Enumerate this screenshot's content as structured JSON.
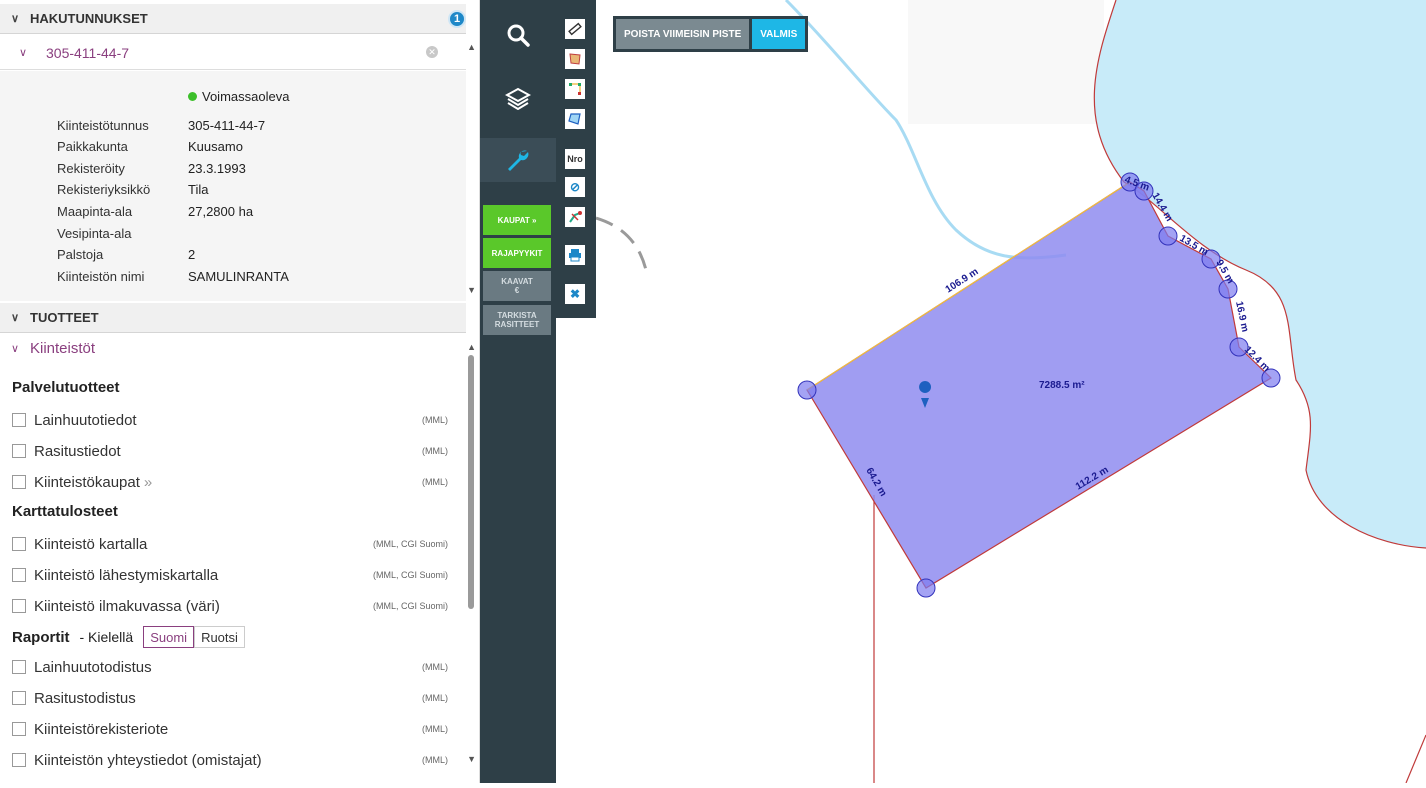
{
  "hits": {
    "title": "HAKUTUNNUKSET",
    "count": "1",
    "parcel_id": "305-411-44-7"
  },
  "details": {
    "status": "Voimassaoleva",
    "rows": [
      {
        "k": "Kiinteistötunnus",
        "v": "305-411-44-7"
      },
      {
        "k": "Paikkakunta",
        "v": "Kuusamo"
      },
      {
        "k": "Rekisteröity",
        "v": "23.3.1993"
      },
      {
        "k": "Rekisteriyksikkö",
        "v": "Tila"
      },
      {
        "k": "Maapinta-ala",
        "v": "27,2800 ha"
      },
      {
        "k": "Vesipinta-ala",
        "v": ""
      },
      {
        "k": "Palstoja",
        "v": "2"
      },
      {
        "k": "Kiinteistön nimi",
        "v": "SAMULINRANTA"
      }
    ]
  },
  "products": {
    "title": "TUOTTEET",
    "category": "Kiinteistöt",
    "groups": {
      "service": "Palvelutuotteet",
      "maps": "Karttatulosteet",
      "reports": "Raportit",
      "reports_lang": "- Kielellä",
      "lang_fi": "Suomi",
      "lang_sv": "Ruotsi"
    },
    "items": [
      {
        "label": "Lainhuutotiedot",
        "src": "(MML)"
      },
      {
        "label": "Rasitustiedot",
        "src": "(MML)"
      },
      {
        "label": "Kiinteistökaupat",
        "src": "(MML)",
        "more": "»"
      },
      {
        "label": "Kiinteistö kartalla",
        "src": "(MML, CGI Suomi)"
      },
      {
        "label": "Kiinteistö lähestymiskartalla",
        "src": "(MML, CGI Suomi)"
      },
      {
        "label": "Kiinteistö ilmakuvassa (väri)",
        "src": "(MML, CGI Suomi)"
      },
      {
        "label": "Lainhuutotodistus",
        "src": "(MML)"
      },
      {
        "label": "Rasitustodistus",
        "src": "(MML)"
      },
      {
        "label": "Kiinteistörekisteriote",
        "src": "(MML)"
      },
      {
        "label": "Kiinteistön yhteystiedot (omistajat)",
        "src": "(MML)"
      }
    ]
  },
  "toolbar": {
    "kaupat": "KAUPAT »",
    "rajapyykit": "RAJAPYYKIT",
    "kaavat": "KAAVAT",
    "kaavat_sub": "€",
    "tarkista1": "TARKISTA",
    "tarkista2": "RASITTEET",
    "nro": "Nro"
  },
  "measure": {
    "remove_last": "POISTA VIIMEISIN PISTE",
    "done": "VALMIS",
    "area": "7288.5 m²",
    "segments": [
      "106.9 m",
      "4.5 m",
      "14.4 m",
      "13.5 m",
      "9.5 m",
      "16.9 m",
      "12.4 m",
      "112.2 m",
      "64.2 m"
    ]
  },
  "colors": {
    "accent": "#8a3f7f",
    "toolbar": "#2e3f47",
    "green": "#5ac82a",
    "cyan": "#1eb7e6",
    "water": "#c8ebf9",
    "polygon": "#8f8cf0"
  }
}
